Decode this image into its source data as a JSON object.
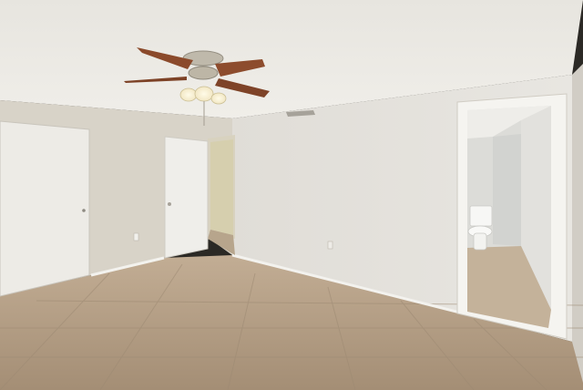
{
  "scene": {
    "subject": "Empty room",
    "palette": {
      "ceiling": "#eceae5",
      "wall_left": "#d9d4c9",
      "wall_back": "#e3e1dc",
      "wall_right": "#d4d0c8",
      "floor_base": "#b5a089",
      "floor_grout": "#9c8a74",
      "door": "#efeeea",
      "trim": "#f4f3ef",
      "fan_blade": "#8a4a2c",
      "fan_metal": "#b9b3a6"
    }
  },
  "watermark": {
    "text": ""
  }
}
